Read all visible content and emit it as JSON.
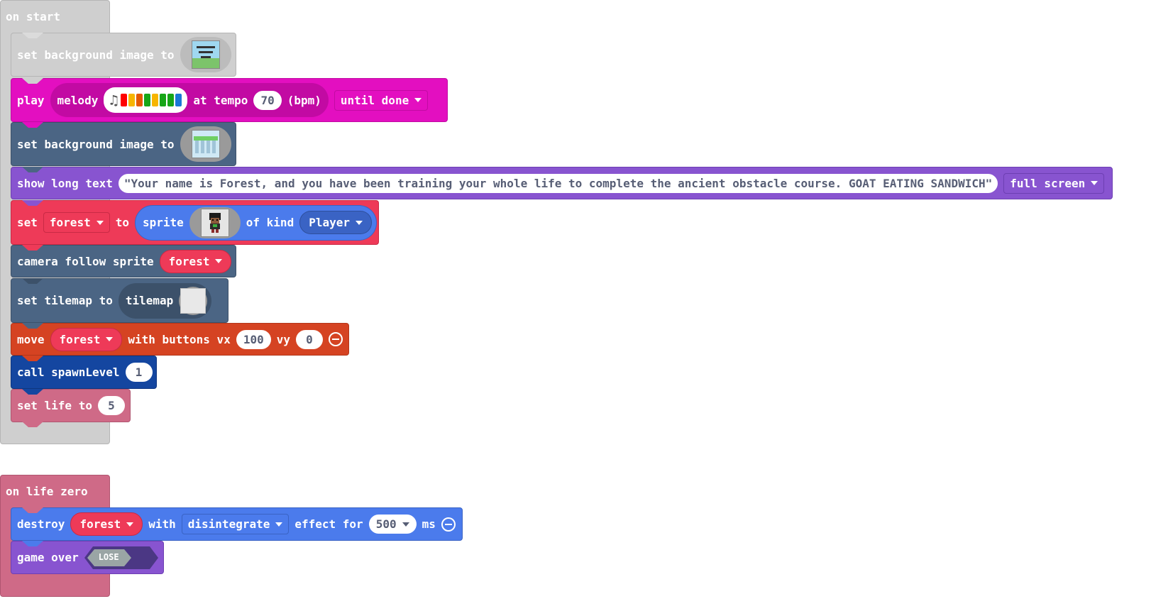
{
  "colors": {
    "start_hat": "#cfcfcf",
    "scene": "#4b6584",
    "music": "#e30fc0",
    "game": "#8854d0",
    "sprites": "#4b7bec",
    "variables": "#ee3a58",
    "controller": "#d54322",
    "functions": "#1446a0",
    "info": "#cf6a87"
  },
  "on_start": {
    "hat_label": "on start",
    "set_bg_1": {
      "label": "set background image to",
      "image_icon": "title-card-image-icon"
    },
    "play": {
      "play_label": "play",
      "melody_label": "melody",
      "note_icon": "music-note-icon",
      "note_colors": [
        "#ff0000",
        "#f7b500",
        "#e45a00",
        "#17a617",
        "#f7b500",
        "#17a617",
        "#17a617",
        "#1a78d6"
      ],
      "tempo_label": "at tempo",
      "tempo_value": "70",
      "bpm_label": "(bpm)",
      "mode_value": "until done"
    },
    "set_bg_2": {
      "label": "set background image to",
      "image_icon": "platform-image-icon"
    },
    "show_text": {
      "label": "show long text",
      "text_value": "Your name is Forest, and you have been training your whole life to complete the ancient obstacle course. GOAT EATING SANDWICH",
      "position_value": "full screen"
    },
    "set_sprite": {
      "set_label": "set",
      "variable": "forest",
      "to_label": "to",
      "sprite_label": "sprite",
      "sprite_icon": "forest-character-icon",
      "kind_label": "of kind",
      "kind_value": "Player"
    },
    "camera": {
      "label": "camera follow sprite",
      "variable": "forest"
    },
    "tilemap": {
      "set_label": "set tilemap to",
      "tilemap_label": "tilemap",
      "tilemap_icon": "tilemap-image-icon"
    },
    "move": {
      "move_label": "move",
      "variable": "forest",
      "buttons_label": "with buttons vx",
      "vx_value": "100",
      "vy_label": "vy",
      "vy_value": "0"
    },
    "call": {
      "label": "call spawnLevel",
      "arg_value": "1"
    },
    "life": {
      "label": "set life to",
      "value": "5"
    }
  },
  "on_life_zero": {
    "hat_label": "on life zero",
    "destroy": {
      "destroy_label": "destroy",
      "variable": "forest",
      "with_label": "with",
      "effect_value": "disintegrate",
      "effect_for_label": "effect for",
      "duration_value": "500",
      "ms_label": "ms"
    },
    "game_over": {
      "label": "game over",
      "outcome_value": "LOSE"
    }
  }
}
